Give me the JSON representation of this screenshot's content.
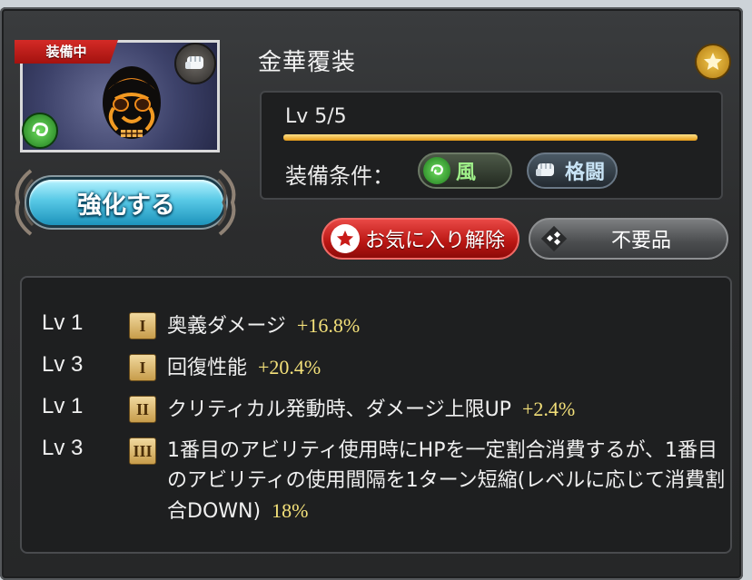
{
  "item": {
    "equipped_label": "装備中",
    "name": "金華覆装",
    "enhance_label": "強化する",
    "level_text": "Lv 5/5",
    "level_progress": 1.0,
    "condition_label": "装備条件：",
    "conditions": [
      {
        "label": "風",
        "icon": "wind-icon"
      },
      {
        "label": "格闘",
        "icon": "fist-icon"
      }
    ]
  },
  "actions": {
    "favorite_remove_label": "お気に入り解除",
    "junk_label": "不要品"
  },
  "skills": [
    {
      "lv": "Lv 1",
      "rank": "I",
      "text": "奥義ダメージ",
      "value": "+16.8%"
    },
    {
      "lv": "Lv 3",
      "rank": "I",
      "text": "回復性能",
      "value": "+20.4%"
    },
    {
      "lv": "Lv 1",
      "rank": "II",
      "text": "クリティカル発動時、ダメージ上限UP",
      "value": "+2.4%"
    },
    {
      "lv": "Lv 3",
      "rank": "III",
      "text": "1番目のアビリティ使用時にHPを一定割合消費するが、1番目のアビリティの使用間隔を1ターン短縮(レベルに応じて消費割合DOWN)",
      "value": "18%"
    }
  ],
  "colors": {
    "accent_gold": "#e59a17",
    "value_yellow": "#f4e17a",
    "favorite_red": "#b91613",
    "wind_green": "#9ff089"
  }
}
